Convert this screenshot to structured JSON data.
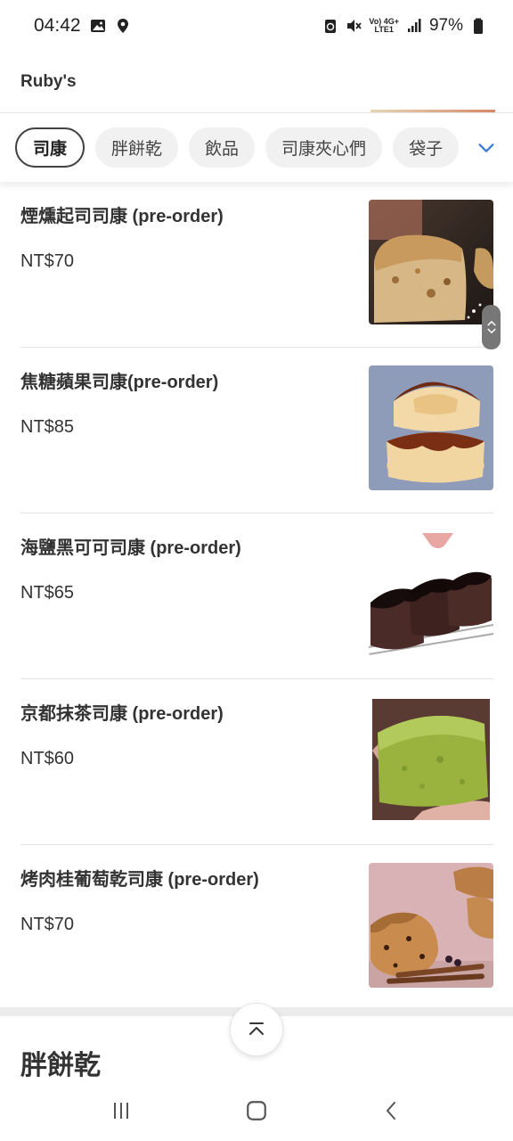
{
  "status_bar": {
    "time": "04:42",
    "battery": "97%",
    "net_line1": "Vo) 4G+",
    "net_line2": "LTE1",
    "icons": [
      "image-icon",
      "location-icon",
      "sync-icon",
      "mute-icon",
      "volte-icon",
      "signal-icon",
      "battery-icon"
    ]
  },
  "header": {
    "shop_name": "Ruby's"
  },
  "categories": {
    "items": [
      {
        "label": "司康",
        "active": true
      },
      {
        "label": "胖餅乾",
        "active": false
      },
      {
        "label": "飲品",
        "active": false
      },
      {
        "label": "司康夾心們",
        "active": false
      },
      {
        "label": "袋子",
        "active": false
      }
    ],
    "expand_icon": "chevron-down-icon",
    "accent_color": "#3a7bd5"
  },
  "products": [
    {
      "name": "煙燻起司司康 (pre-order)",
      "price": "NT$70"
    },
    {
      "name": "焦糖蘋果司康(pre-order)",
      "price": "NT$85"
    },
    {
      "name": "海鹽黑可可司康 (pre-order)",
      "price": "NT$65"
    },
    {
      "name": "京都抹茶司康 (pre-order)",
      "price": "NT$60"
    },
    {
      "name": "烤肉桂葡萄乾司康 (pre-order)",
      "price": "NT$70"
    }
  ],
  "next_section": {
    "title": "胖餅乾"
  },
  "nav": {
    "icons": [
      "recent-apps-icon",
      "home-icon",
      "back-icon"
    ]
  }
}
